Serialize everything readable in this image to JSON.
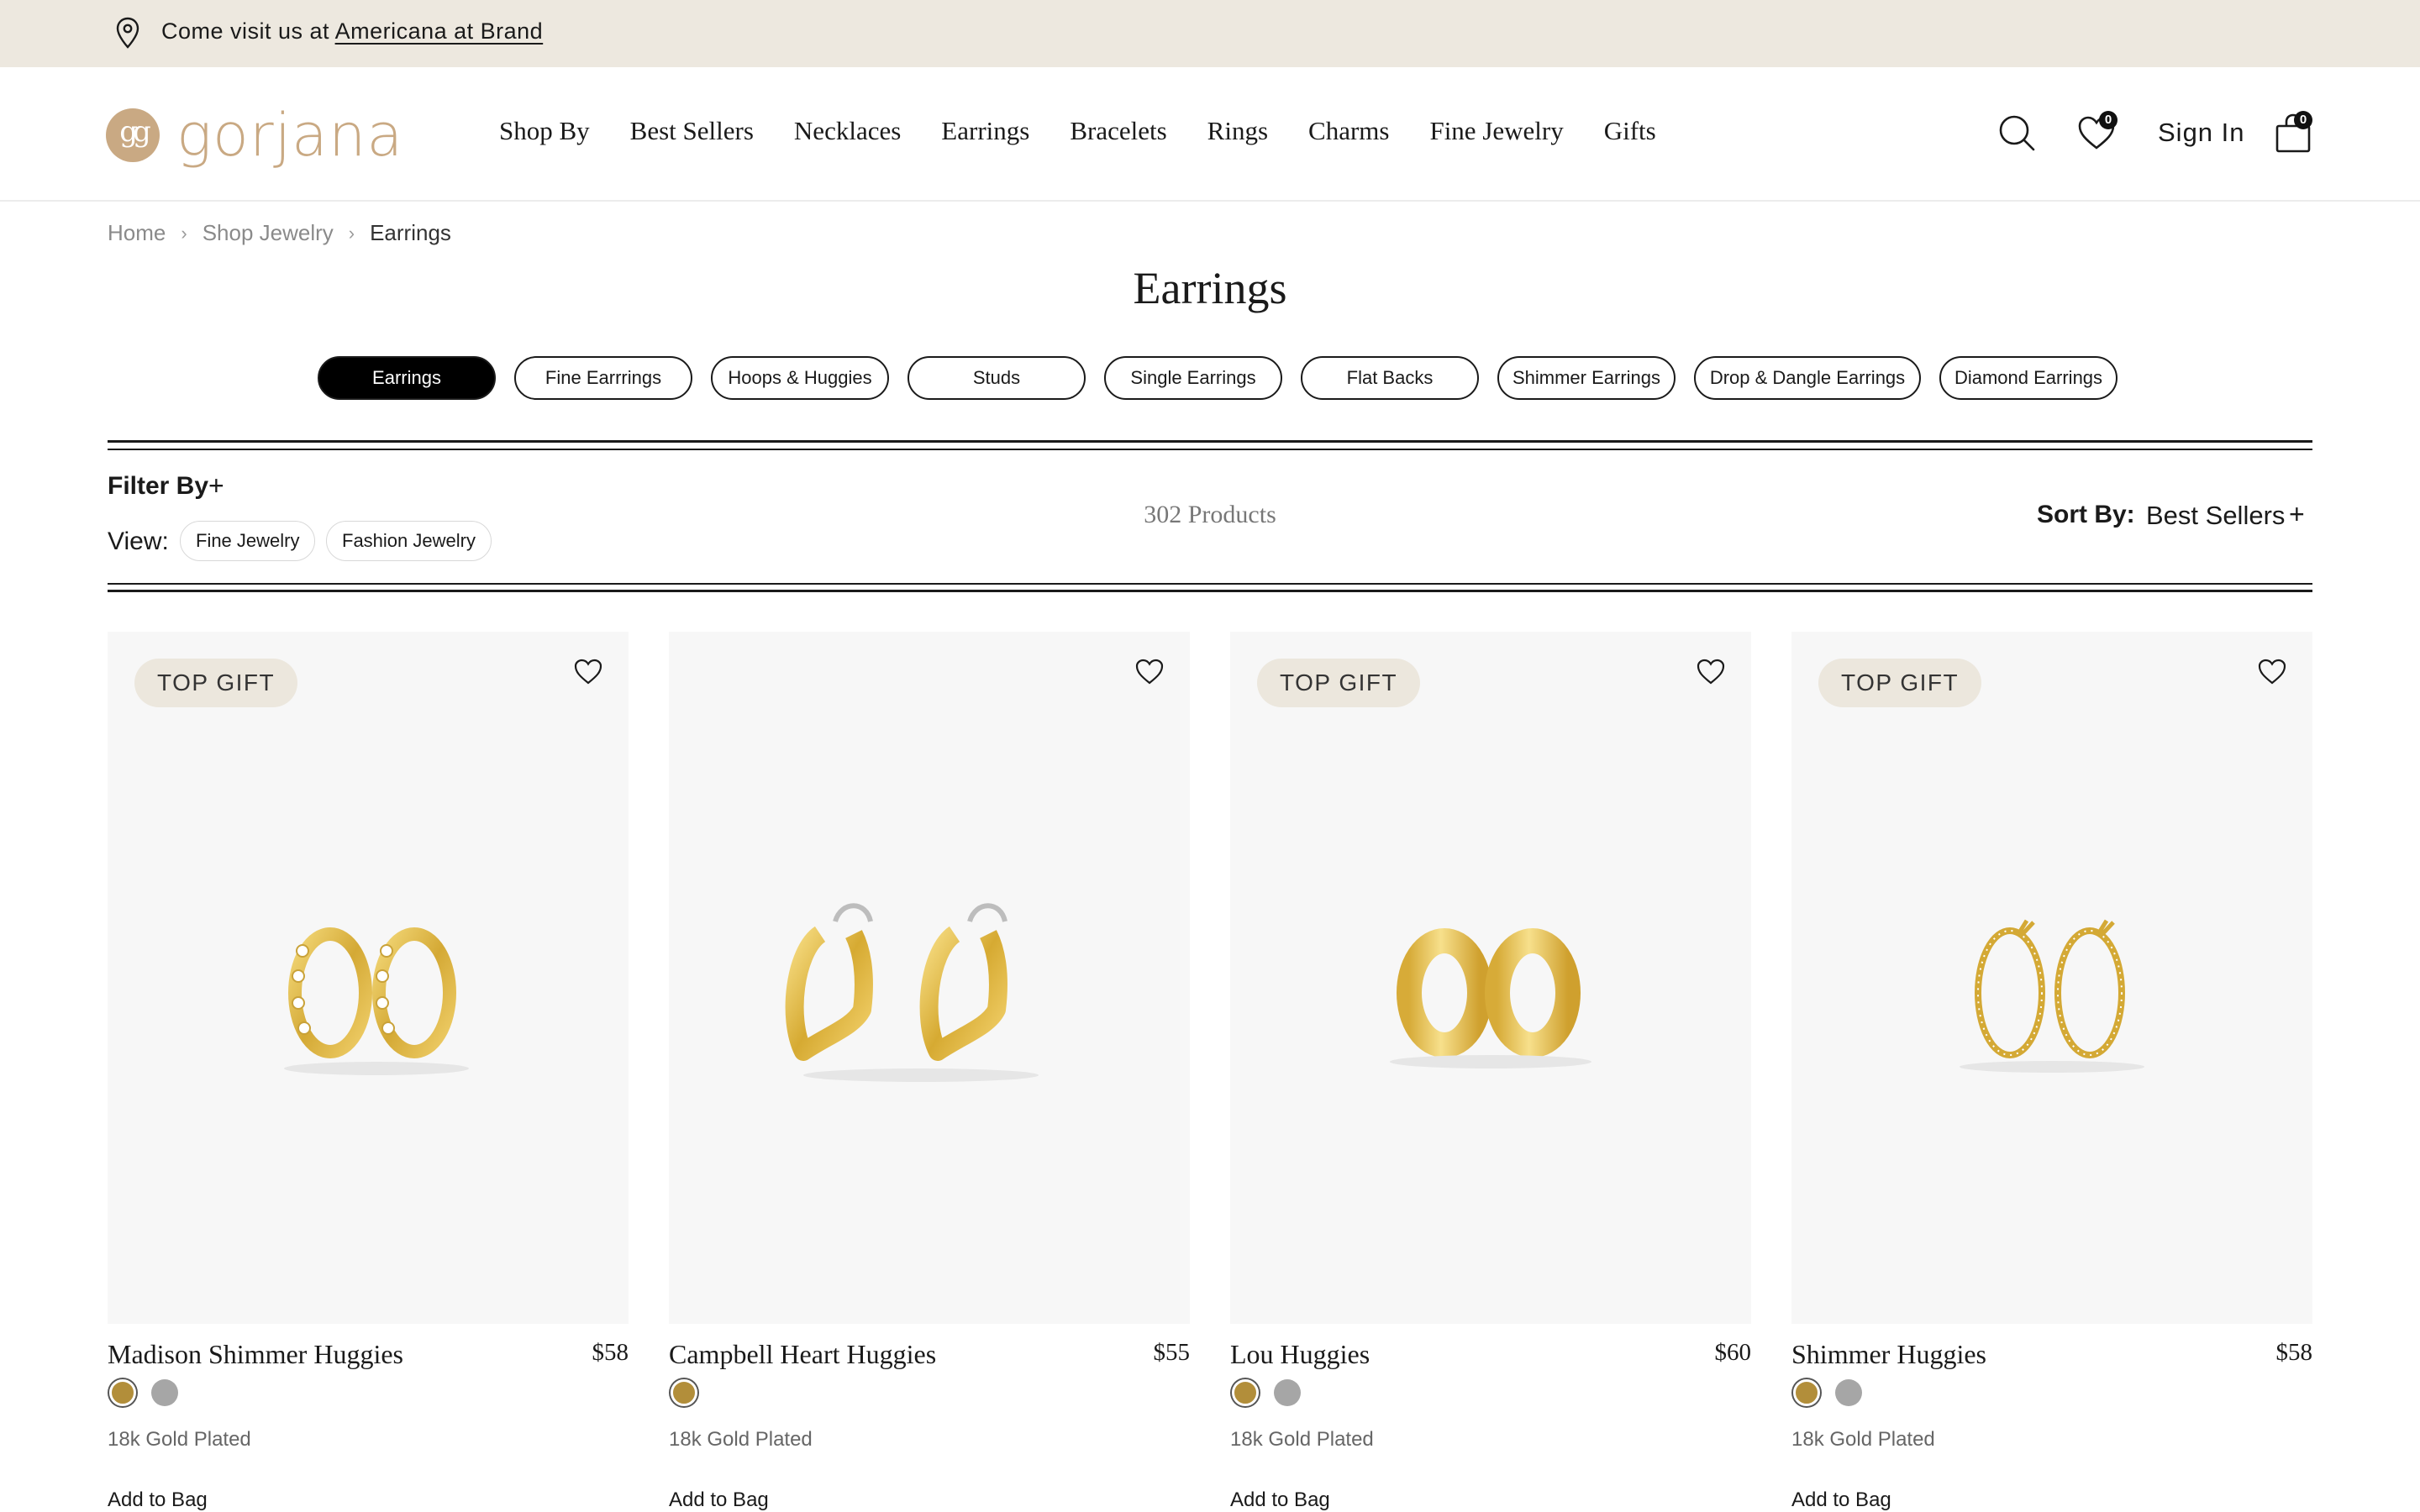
{
  "announcement": {
    "prefix": "Come visit us at",
    "link": "Americana at Brand"
  },
  "brand": {
    "logo_text": "gorjana",
    "logo_mark": "gg",
    "color": "#c9a983"
  },
  "nav": [
    "Shop By",
    "Best Sellers",
    "Necklaces",
    "Earrings",
    "Bracelets",
    "Rings",
    "Charms",
    "Fine Jewelry",
    "Gifts"
  ],
  "header": {
    "sign_in": "Sign In",
    "wishlist_count": "0",
    "bag_count": "0"
  },
  "breadcrumb": [
    "Home",
    "Shop Jewelry",
    "Earrings"
  ],
  "page_title": "Earrings",
  "categories": [
    {
      "label": "Earrings",
      "active": true
    },
    {
      "label": "Fine Earrrings",
      "active": false
    },
    {
      "label": "Hoops & Huggies",
      "active": false
    },
    {
      "label": "Studs",
      "active": false
    },
    {
      "label": "Single Earrings",
      "active": false
    },
    {
      "label": "Flat Backs",
      "active": false
    },
    {
      "label": "Shimmer Earrings",
      "active": false
    },
    {
      "label": "Drop & Dangle Earrings",
      "active": false
    },
    {
      "label": "Diamond Earrings",
      "active": false
    }
  ],
  "filters": {
    "filter_by_label": "Filter By",
    "plus": "+",
    "view_label": "View:",
    "view_options": [
      "Fine Jewelry",
      "Fashion Jewelry"
    ],
    "product_count": "302 Products",
    "sort_label": "Sort By:",
    "sort_value": "Best Sellers"
  },
  "products": [
    {
      "badge": "TOP GIFT",
      "name": "Madison Shimmer Huggies",
      "price": "$58",
      "finish": "18k Gold Plated",
      "swatches": [
        "gold",
        "silver"
      ],
      "action": "Add to Bag"
    },
    {
      "badge": "",
      "name": "Campbell Heart Huggies",
      "price": "$55",
      "finish": "18k Gold Plated",
      "swatches": [
        "gold"
      ],
      "action": "Add to Bag"
    },
    {
      "badge": "TOP GIFT",
      "name": "Lou Huggies",
      "price": "$60",
      "finish": "18k Gold Plated",
      "swatches": [
        "gold",
        "silver"
      ],
      "action": "Add to Bag"
    },
    {
      "badge": "TOP GIFT",
      "name": "Shimmer Huggies",
      "price": "$58",
      "finish": "18k Gold Plated",
      "swatches": [
        "gold",
        "silver"
      ],
      "action": "Add to Bag"
    }
  ],
  "colors": {
    "gold": "#b28e3a",
    "silver": "#a6a6a6",
    "announce_bg": "#ede8df",
    "tag_bg": "#ece7dd"
  }
}
